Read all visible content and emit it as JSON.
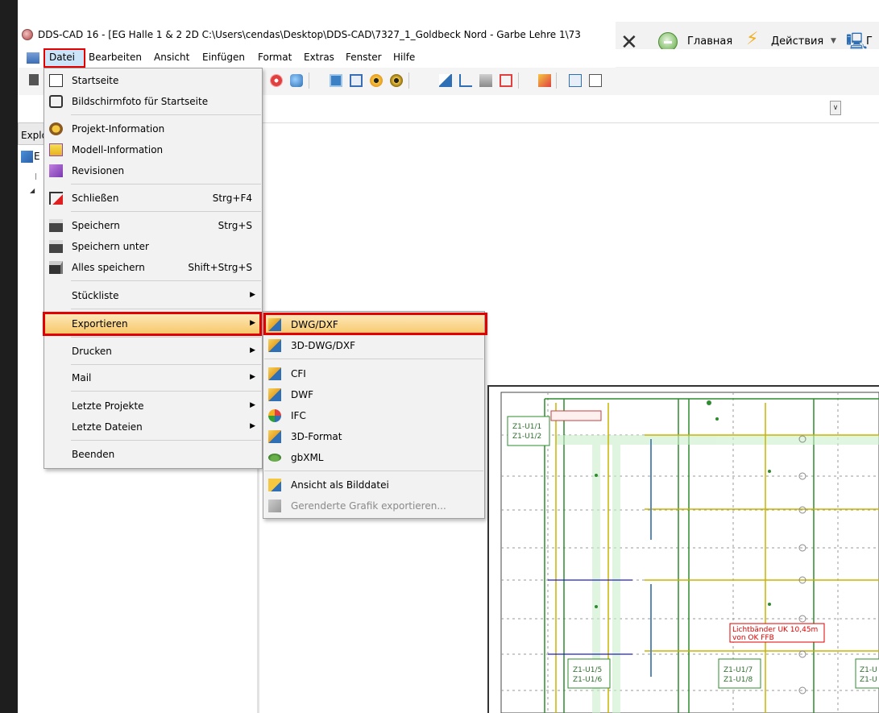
{
  "window": {
    "title": "DDS-CAD 16 - [EG Halle 1 & 2  2D  C:\\Users\\cendas\\Desktop\\DDS-CAD\\7327_1_Goldbeck Nord - Garbe Lehre 1\\73"
  },
  "overlay_toolbar": {
    "home_label": "Главная",
    "actions_label": "Действия",
    "cut_label": "Г"
  },
  "menubar": {
    "items": [
      "Datei",
      "Bearbeiten",
      "Ansicht",
      "Einfügen",
      "Format",
      "Extras",
      "Fenster",
      "Hilfe"
    ]
  },
  "explorer": {
    "tab_label": "Explo",
    "root_label": "E"
  },
  "file_menu": {
    "items": [
      {
        "label": "Startseite",
        "icon": "startpage-icon"
      },
      {
        "label": "Bildschirmfoto für Startseite",
        "icon": "camera-icon"
      },
      {
        "label": "Projekt-Information",
        "icon": "project-info-icon"
      },
      {
        "label": "Modell-Information",
        "icon": "model-info-icon"
      },
      {
        "label": "Revisionen",
        "icon": "revisions-icon"
      },
      {
        "label": "Schließen",
        "shortcut": "Strg+F4",
        "icon": "close-file-icon"
      },
      {
        "label": "Speichern",
        "shortcut": "Strg+S",
        "icon": "save-icon"
      },
      {
        "label": "Speichern unter",
        "icon": "save-as-icon"
      },
      {
        "label": "Alles speichern",
        "shortcut": "Shift+Strg+S",
        "icon": "save-all-icon"
      },
      {
        "label": "Stückliste",
        "submenu": true
      },
      {
        "label": "Exportieren",
        "submenu": true,
        "highlighted": true
      },
      {
        "label": "Drucken",
        "submenu": true
      },
      {
        "label": "Mail",
        "submenu": true
      },
      {
        "label": "Letzte Projekte",
        "submenu": true
      },
      {
        "label": "Letzte Dateien",
        "submenu": true
      },
      {
        "label": "Beenden"
      }
    ]
  },
  "export_submenu": {
    "items": [
      {
        "label": "DWG/DXF",
        "highlighted": true,
        "icon": "dwg-icon"
      },
      {
        "label": "3D-DWG/DXF",
        "icon": "dwg3d-icon"
      },
      {
        "label": "CFI",
        "icon": "cfi-icon"
      },
      {
        "label": "DWF",
        "icon": "dwf-icon"
      },
      {
        "label": "IFC",
        "icon": "ifc-icon"
      },
      {
        "label": "3D-Format",
        "icon": "format3d-icon"
      },
      {
        "label": "gbXML",
        "icon": "gbxml-icon"
      },
      {
        "label": "Ansicht als Bilddatei",
        "icon": "image-file-icon"
      },
      {
        "label": "Gerenderte Grafik exportieren...",
        "disabled": true,
        "icon": "render-icon"
      }
    ]
  },
  "drawing": {
    "labels": [
      "Z1-U1/1",
      "Z1-U1/2",
      "Z1-U1/5",
      "Z1-U1/6",
      "Z1-U1/7",
      "Z1-U1/8",
      "Z1-U",
      "Z1-U"
    ],
    "note_line1": "Lichtbänder UK  10,45m",
    "note_line2": "von OK FFB"
  },
  "colors": {
    "highlight_red": "#e30000",
    "menu_highlight": "#f7c86a",
    "drawing_green": "#2e8b2e",
    "drawing_yellow": "#c8b400"
  }
}
